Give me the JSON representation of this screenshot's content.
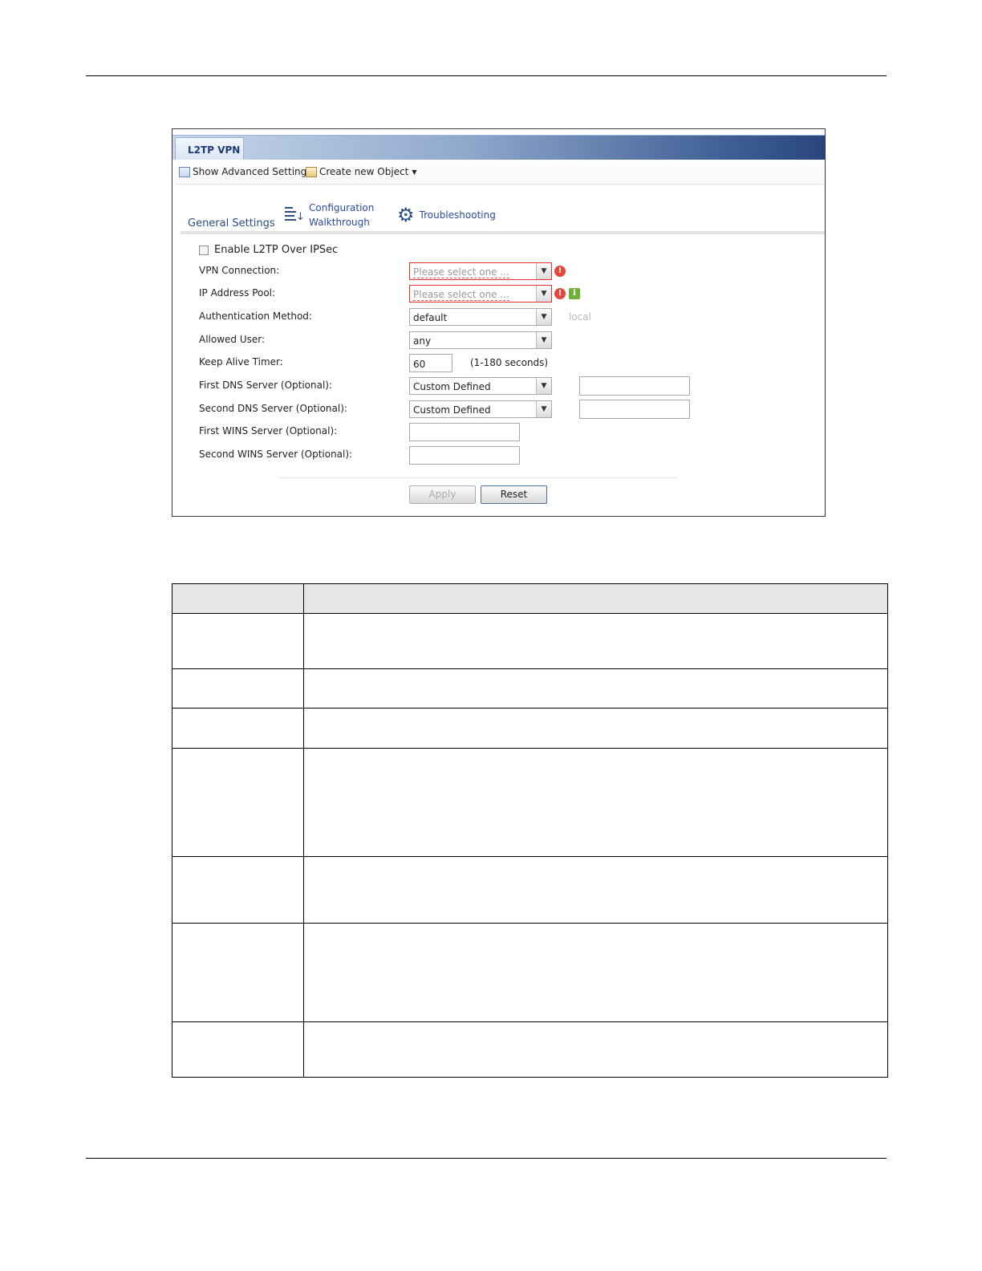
{
  "tab": {
    "label": "L2TP VPN"
  },
  "toolbar": {
    "show_advanced": "Show Advanced Settings",
    "create_object": "Create new Object"
  },
  "section": {
    "title": "General Settings"
  },
  "links": {
    "walkthrough_line1": "Configuration",
    "walkthrough_line2": "Walkthrough",
    "troubleshooting": "Troubleshooting"
  },
  "form": {
    "enable_label": "Enable L2TP Over IPSec",
    "enable_checked": false,
    "vpn_connection": {
      "label": "VPN Connection:",
      "value": "Please select one ..."
    },
    "ip_pool": {
      "label": "IP Address Pool:",
      "value": "Please select one ..."
    },
    "auth_method": {
      "label": "Authentication Method:",
      "value": "default",
      "note": "local"
    },
    "allowed_user": {
      "label": "Allowed User:",
      "value": "any"
    },
    "keep_alive": {
      "label": "Keep Alive Timer:",
      "value": "60",
      "hint": "(1-180 seconds)"
    },
    "first_dns": {
      "label": "First DNS Server (Optional):",
      "value": "Custom Defined",
      "address": ""
    },
    "second_dns": {
      "label": "Second DNS Server (Optional):",
      "value": "Custom Defined",
      "address": ""
    },
    "first_wins": {
      "label": "First WINS Server (Optional):",
      "value": ""
    },
    "second_wins": {
      "label": "Second WINS Server (Optional):",
      "value": ""
    }
  },
  "buttons": {
    "apply": "Apply",
    "reset": "Reset"
  },
  "icons": {
    "error": "error-icon",
    "info": "info-icon",
    "gear": "troubleshooting-gear-icon"
  },
  "colors": {
    "tab_bar_dark": "#28467c",
    "link": "#2b4c9e",
    "error": "#e4473e",
    "info": "#6fb03a"
  }
}
